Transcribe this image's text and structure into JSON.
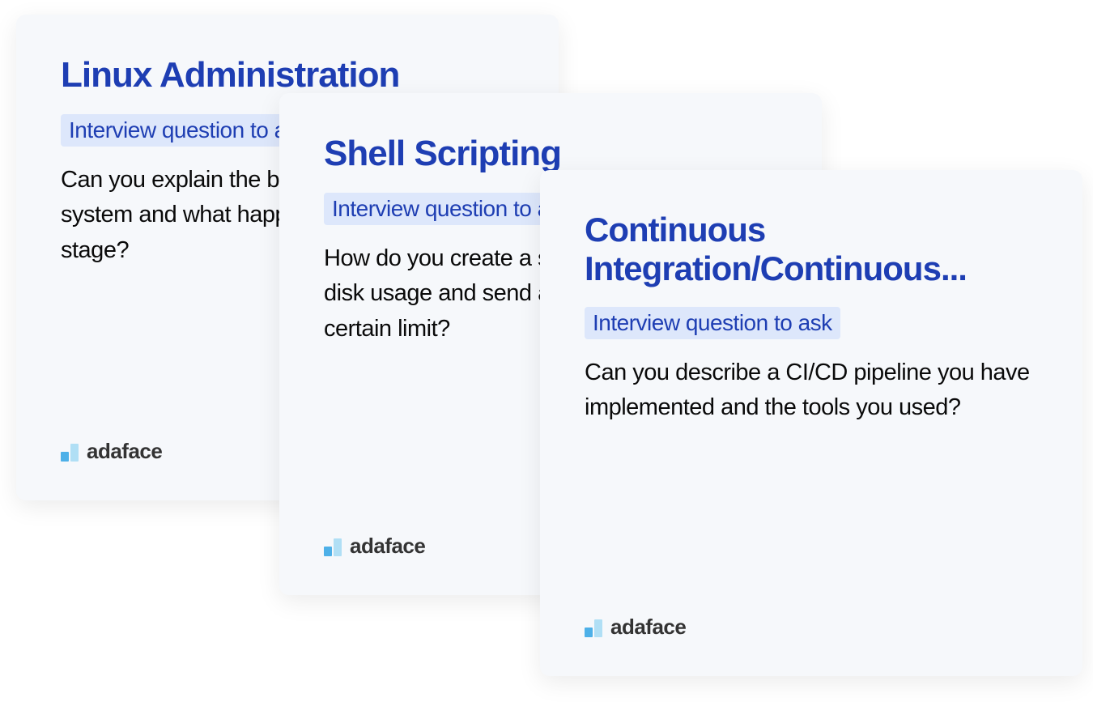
{
  "cards": [
    {
      "title": "Linux Administration",
      "subtitle": "Interview question to ask",
      "question": "Can you explain the boot process of a Linux system and what happens during each stage?"
    },
    {
      "title": "Shell Scripting",
      "subtitle": "Interview question to ask",
      "question": "How do you create a shell script to monitor disk usage and send an alert if it exceeds a certain limit?"
    },
    {
      "title": "Continuous Integration/Continuous...",
      "subtitle": "Interview question to ask",
      "question": "Can you describe a CI/CD pipeline you have implemented and the tools you used?"
    }
  ],
  "brand": {
    "name": "adaface"
  }
}
